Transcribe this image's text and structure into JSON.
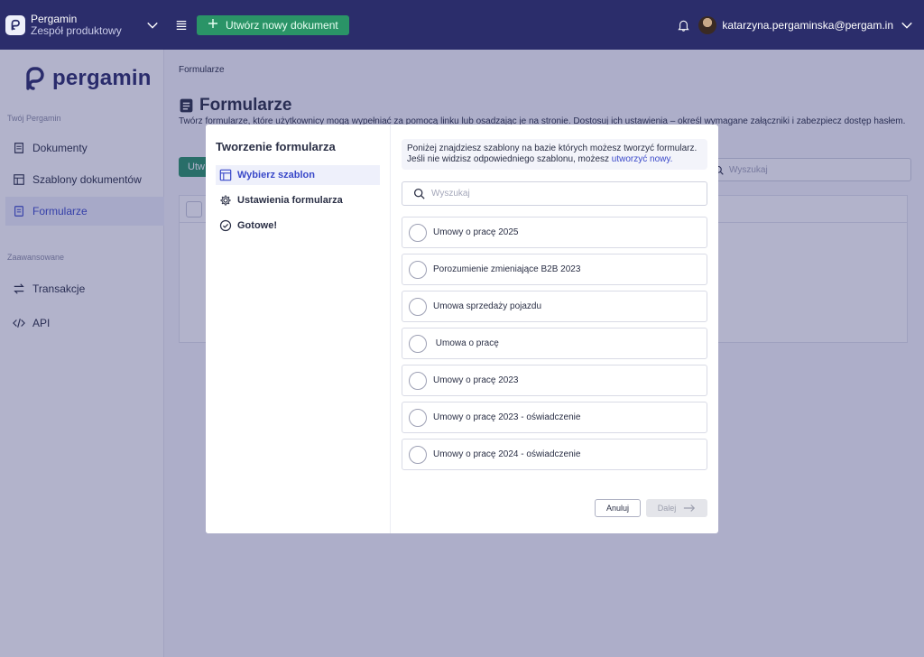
{
  "topbar": {
    "org_name": "Pergamin",
    "org_team": "Zespół produktowy",
    "create_button": "Utwórz nowy dokument",
    "user_email": "katarzyna.pergaminska@pergam.in"
  },
  "sidebar": {
    "brand": "pergamin",
    "section1": "Twój Pergamin",
    "items1": [
      {
        "label": "Dokumenty",
        "icon": "document-icon"
      },
      {
        "label": "Szablony dokumentów",
        "icon": "template-icon"
      },
      {
        "label": "Formularze",
        "icon": "form-icon",
        "active": true
      }
    ],
    "section2": "Zaawansowane",
    "items2": [
      {
        "label": "Transakcje",
        "icon": "transfer-icon"
      },
      {
        "label": "API",
        "icon": "code-icon"
      }
    ]
  },
  "main": {
    "breadcrumb": "Formularze",
    "title": "Formularze",
    "description": "Twórz formularze, które użytkownicy mogą wypełniać za pomocą linku lub osadzając je na stronie. Dostosuj ich ustawienia – określ wymagane załączniki i zabezpiecz dostęp hasłem.",
    "create_button": "Utw",
    "search_placeholder": "Wyszukaj"
  },
  "modal": {
    "title": "Tworzenie formularza",
    "steps": [
      {
        "label": "Wybierz szablon",
        "icon": "layout-icon",
        "active": true
      },
      {
        "label": "Ustawienia formularza",
        "icon": "gear-icon"
      },
      {
        "label": "Gotowe!",
        "icon": "check-circle-icon"
      }
    ],
    "info_text": "Poniżej znajdziesz szablony na bazie których możesz tworzyć formularz. Jeśli nie widzisz odpowiedniego szablonu, możesz",
    "info_link": "utworzyć nowy.",
    "search_placeholder": "Wyszukaj",
    "templates": [
      "Umowy o pracę 2025",
      "Porozumienie zmieniające B2B 2023",
      "Umowa sprzedaży pojazdu",
      " Umowa o pracę",
      "Umowy o pracę 2023",
      "Umowy o pracę 2023 - oświadczenie",
      "Umowy o pracę 2024 - oświadczenie"
    ],
    "cancel_button": "Anuluj",
    "next_button": "Dalej"
  },
  "colors": {
    "topbar": "#2b2d6b",
    "accent": "#3a49c9",
    "success": "#2a9467"
  }
}
